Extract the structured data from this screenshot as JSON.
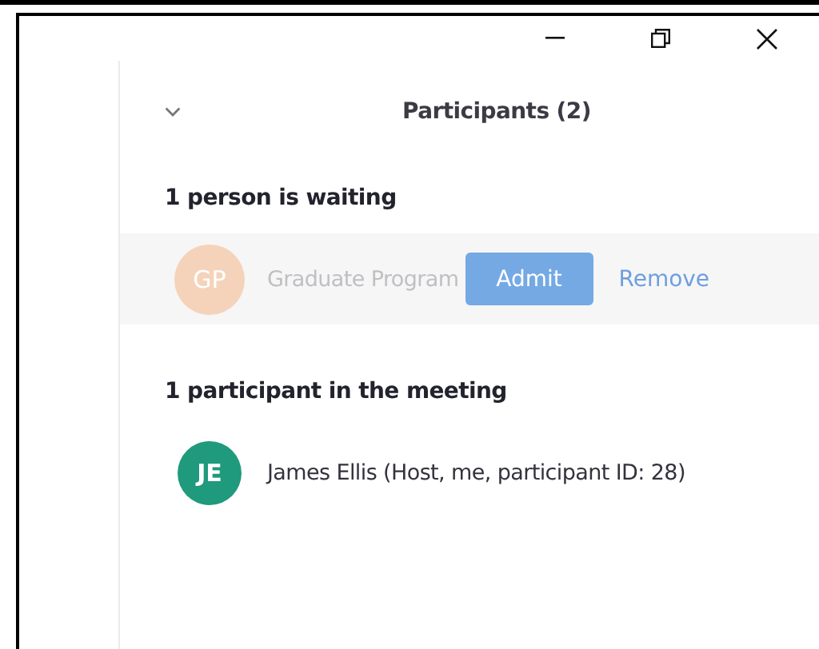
{
  "window": {
    "controls": [
      {
        "kind": "minimize"
      },
      {
        "kind": "restore"
      },
      {
        "kind": "close"
      }
    ]
  },
  "panel": {
    "title": "Participants (2)",
    "collapsed": false
  },
  "sections": [
    {
      "heading": "1 person is waiting",
      "rows": [
        {
          "initials": "GP",
          "name": "Graduate Program",
          "color": "#f5d3ba",
          "dimmed": true,
          "actions": [
            {
              "label": "Admit",
              "kind": "primary"
            },
            {
              "label": "Remove",
              "kind": "link"
            }
          ]
        }
      ]
    },
    {
      "heading": "1 participant in the meeting",
      "rows": [
        {
          "initials": "JE",
          "name": "James Ellis (Host, me, participant ID: 28)",
          "color": "#1f9a7c",
          "dimmed": false
        }
      ]
    }
  ]
}
